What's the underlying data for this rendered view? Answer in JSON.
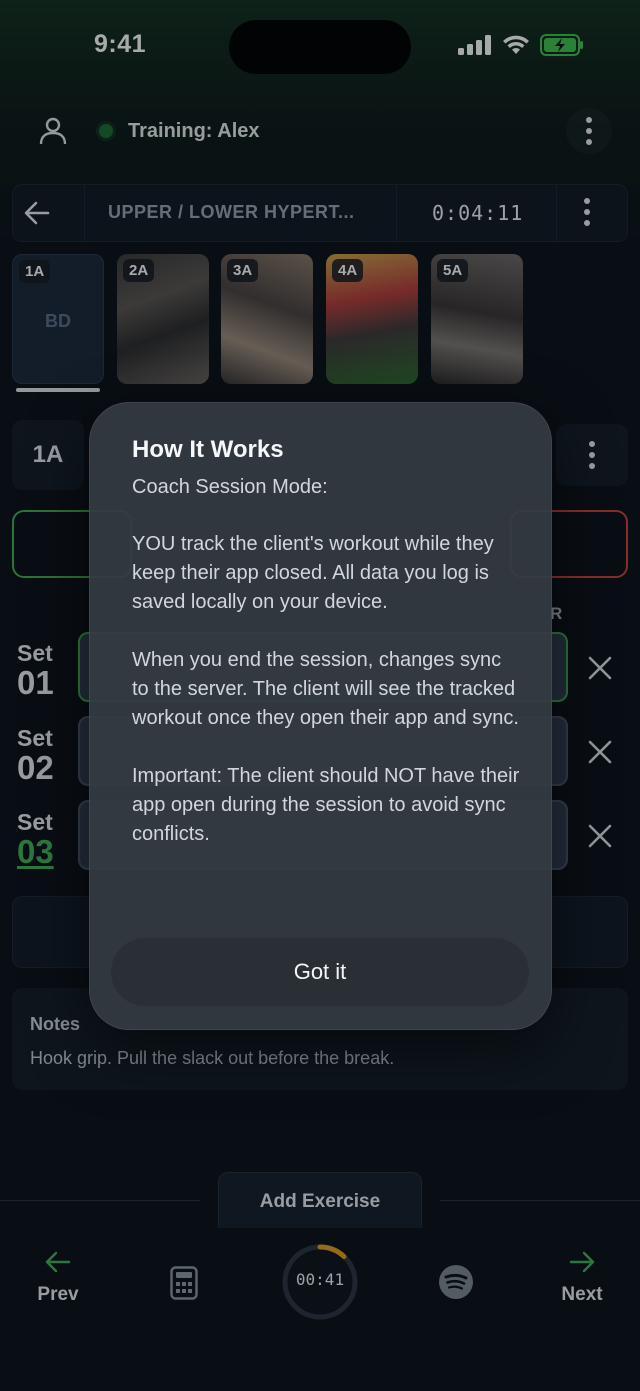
{
  "status_bar": {
    "time": "9:41"
  },
  "header": {
    "training_label": "Training: Alex"
  },
  "session": {
    "workout_name": "UPPER / LOWER HYPERT...",
    "elapsed": "0:04:11"
  },
  "exercises": [
    {
      "tag": "1A",
      "placeholder": "BD"
    },
    {
      "tag": "2A"
    },
    {
      "tag": "3A"
    },
    {
      "tag": "4A"
    },
    {
      "tag": "5A"
    }
  ],
  "current_exercise": {
    "tag": "1A",
    "column_hint": "R"
  },
  "sets": [
    {
      "label": "Set",
      "number": "01"
    },
    {
      "label": "Set",
      "number": "02"
    },
    {
      "label": "Set",
      "number": "03"
    }
  ],
  "notes": {
    "title": "Notes",
    "text": "Hook grip. Pull the slack out before the break."
  },
  "add_exercise_label": "Add Exercise",
  "bottom_nav": {
    "prev": "Prev",
    "next": "Next",
    "rest_timer": "00:41",
    "rest_progress": 0.12
  },
  "modal": {
    "title": "How It Works",
    "subtitle": "Coach Session Mode:",
    "paragraphs": [
      "YOU track the client's workout while they keep their app closed. All data you log is saved locally on your device.",
      "When you end the session, changes sync to the server. The client will see the tracked workout once they open their app and sync.",
      "Important: The client should NOT have their app open during the session to avoid sync conflicts."
    ],
    "button": "Got it"
  },
  "colors": {
    "accent_green": "#43b25a",
    "danger_red": "#c9433d",
    "timer_orange": "#e0a020"
  },
  "icons": [
    "user-icon",
    "kebab-icon",
    "back-arrow-icon",
    "close-icon",
    "calculator-icon",
    "spotify-icon",
    "arrow-left-icon",
    "arrow-right-icon"
  ]
}
